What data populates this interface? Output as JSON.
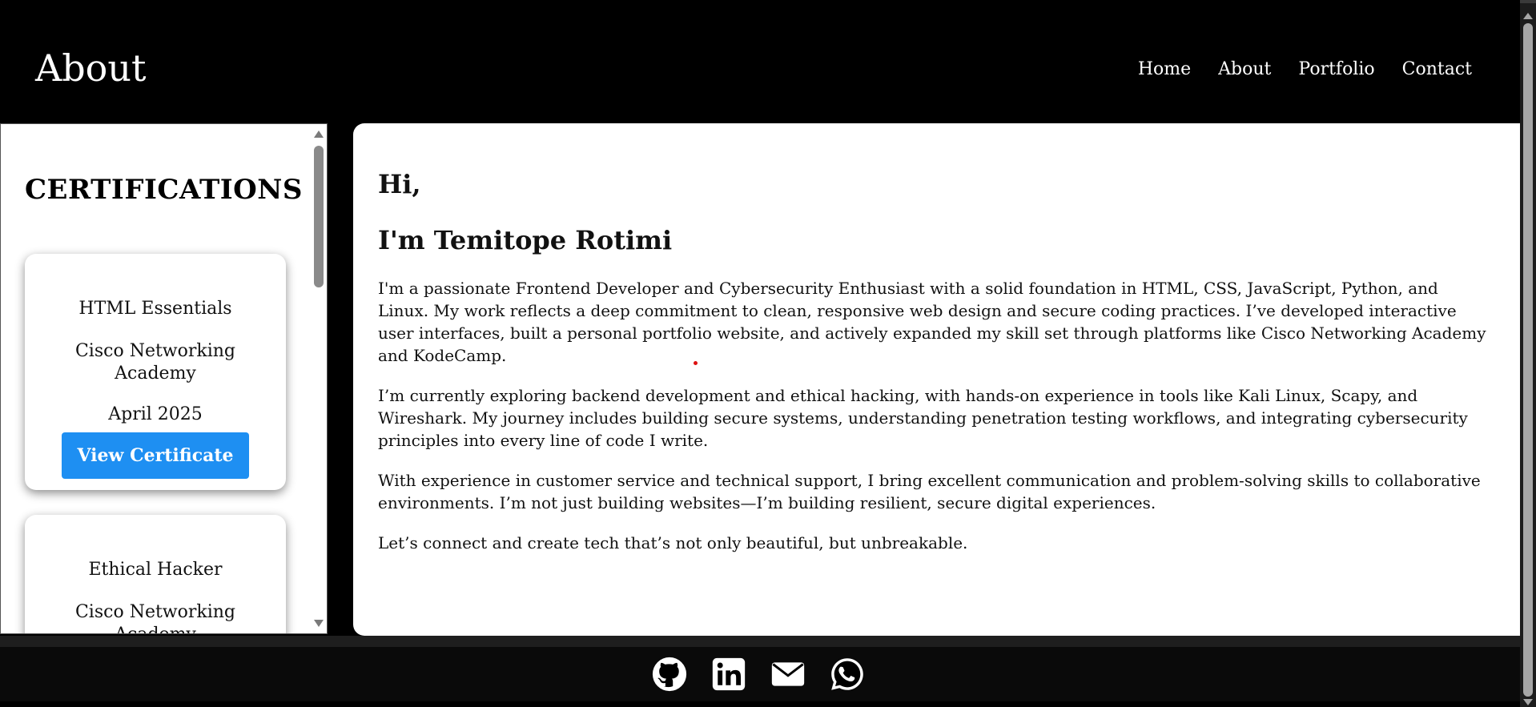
{
  "header": {
    "title": "About"
  },
  "nav": {
    "items": [
      "Home",
      "About",
      "Portfolio",
      "Contact"
    ]
  },
  "certifications": {
    "heading": "CERTIFICATIONS",
    "cards": [
      {
        "title": "HTML Essentials",
        "issuer": "Cisco Networking Academy",
        "date": "April 2025",
        "button": "View Certificate"
      },
      {
        "title": "Ethical Hacker",
        "issuer": "Cisco Networking Academy"
      }
    ]
  },
  "about": {
    "greeting": "Hi,",
    "name": "I'm Temitope Rotimi",
    "paragraphs": [
      "I'm a passionate Frontend Developer and Cybersecurity Enthusiast with a solid foundation in HTML, CSS, JavaScript, Python, and Linux. My work reflects a deep commitment to clean, responsive web design and secure coding practices. I’ve developed interactive user interfaces, built a personal portfolio website, and actively expanded my skill set through platforms like Cisco Networking Academy and KodeCamp.",
      "I’m currently exploring backend development and ethical hacking, with hands-on experience in tools like Kali Linux, Scapy, and Wireshark. My journey includes building secure systems, understanding penetration testing workflows, and integrating cybersecurity principles into every line of code I write.",
      "With experience in customer service and technical support, I bring excellent communication and problem-solving skills to collaborative environments. I’m not just building websites—I’m building resilient, secure digital experiences.",
      "Let’s connect and create tech that’s not only beautiful, but unbreakable."
    ]
  },
  "footer": {
    "icons": [
      "github-icon",
      "linkedin-icon",
      "mail-icon",
      "whatsapp-icon"
    ]
  },
  "colors": {
    "accent": "#1e8ff2",
    "header_bg": "#000000"
  }
}
